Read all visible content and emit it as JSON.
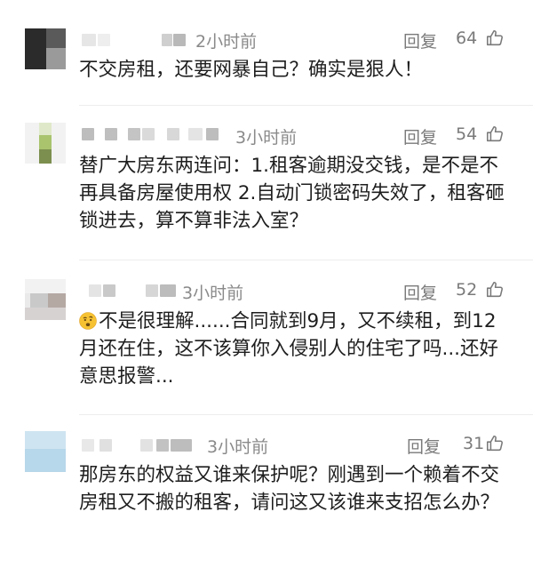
{
  "comments": [
    {
      "time": "2小时前",
      "reply_label": "回复",
      "likes": "64",
      "text": "不交房租，还要网暴自己？确实是狠人！"
    },
    {
      "time": "3小时前",
      "reply_label": "回复",
      "likes": "54",
      "text": "替广大房东两连问：1.租客逾期没交钱，是不是不再具备房屋使用权 2.自动门锁密码失效了，租客砸锁进去，算不算非法入室？"
    },
    {
      "time": "3小时前",
      "reply_label": "回复",
      "likes": "52",
      "emoji": "thinking-face-emoji",
      "text": "不是很理解......合同就到9月，又不续租，到12月还在住，这不该算你入侵别人的住宅了吗...还好意思报警..."
    },
    {
      "time": "3小时前",
      "reply_label": "回复",
      "likes": "31",
      "text": "那房东的权益又谁来保护呢？刚遇到一个赖着不交房租又不搬的租客，请问这又该谁来支招怎么办？"
    }
  ],
  "icons": {
    "like": "thumbs-up-icon"
  },
  "colors": {
    "meta_text": "#8a8a8a",
    "body_text": "#1e1e1e"
  }
}
